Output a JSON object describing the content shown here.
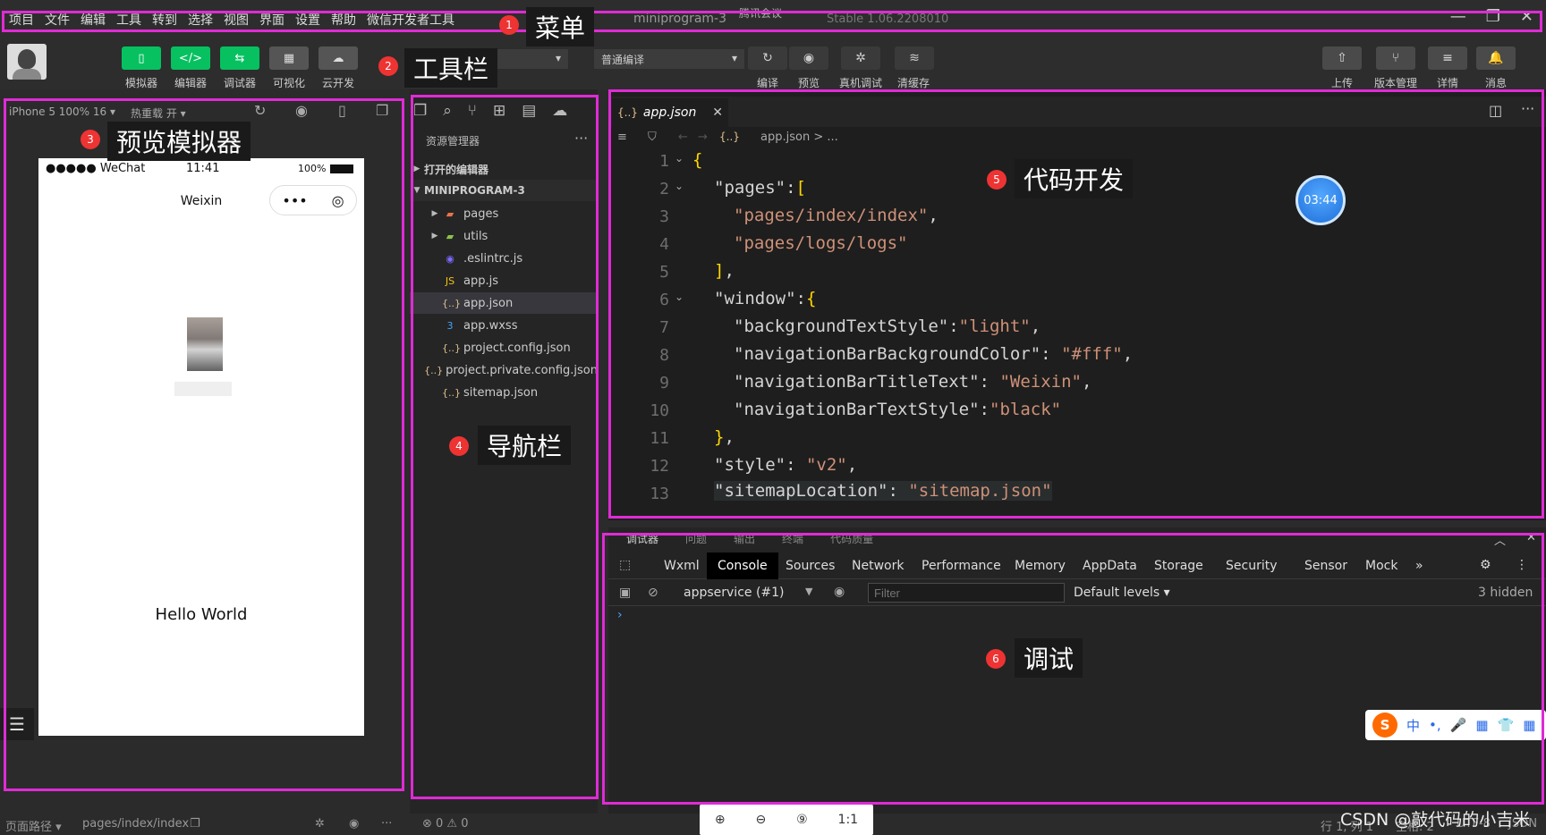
{
  "menubar": {
    "items": [
      "项目",
      "文件",
      "编辑",
      "工具",
      "转到",
      "选择",
      "视图",
      "界面",
      "设置",
      "帮助",
      "微信开发者工具"
    ],
    "window_title": "miniprogram-3",
    "meeting": "腾讯会议",
    "version": "Stable 1.06.2208010",
    "controls": [
      "—",
      "❐",
      "✕"
    ]
  },
  "toolbar": {
    "mode_buttons": [
      {
        "label": "模拟器",
        "icon": "▯"
      },
      {
        "label": "编辑器",
        "icon": "</>"
      },
      {
        "label": "调试器",
        "icon": "⇆"
      },
      {
        "label": "可视化",
        "icon": "▦"
      },
      {
        "label": "云开发",
        "icon": "☁"
      }
    ],
    "compile_mode": "普通编译",
    "actions": [
      {
        "label": "编译",
        "icon": "↻"
      },
      {
        "label": "预览",
        "icon": "◉"
      },
      {
        "label": "真机调试",
        "icon": "✲"
      },
      {
        "label": "清缓存",
        "icon": "≋"
      }
    ],
    "right_actions": [
      {
        "label": "上传",
        "icon": "⇧"
      },
      {
        "label": "版本管理",
        "icon": "⑂"
      },
      {
        "label": "详情",
        "icon": "≡"
      },
      {
        "label": "消息",
        "icon": "🔔"
      }
    ]
  },
  "simulator": {
    "device": "iPhone 5 100% 16 ▾",
    "hot_reload": "热重载 开 ▾",
    "status_left": "●●●●● WeChat",
    "status_time": "11:41",
    "status_battery": "100%",
    "nav_title": "Weixin",
    "hello": "Hello World"
  },
  "explorer": {
    "header": "资源管理器",
    "open_editors": "打开的编辑器",
    "project": "MINIPROGRAM-3",
    "items": [
      {
        "name": "pages",
        "icon": "▰",
        "color": "#e8734a",
        "folder": true
      },
      {
        "name": "utils",
        "icon": "▰",
        "color": "#8bc34a",
        "folder": true
      },
      {
        "name": ".eslintrc.js",
        "icon": "◉",
        "color": "#7c6bff",
        "folder": false
      },
      {
        "name": "app.js",
        "icon": "JS",
        "color": "#f1c40f",
        "folder": false
      },
      {
        "name": "app.json",
        "icon": "{..}",
        "color": "#e2c08d",
        "folder": false
      },
      {
        "name": "app.wxss",
        "icon": "3",
        "color": "#42a5f5",
        "folder": false
      },
      {
        "name": "project.config.json",
        "icon": "{..}",
        "color": "#e2c08d",
        "folder": false
      },
      {
        "name": "project.private.config.json",
        "icon": "{..}",
        "color": "#e2c08d",
        "folder": false
      },
      {
        "name": "sitemap.json",
        "icon": "{..}",
        "color": "#e2c08d",
        "folder": false
      }
    ]
  },
  "editor": {
    "tab_name": "app.json",
    "breadcrumb": "app.json > ...",
    "timer": "03:44"
  },
  "debugger": {
    "top_tabs": [
      "调试器",
      "问题",
      "输出",
      "终端",
      "代码质量"
    ],
    "tabs": [
      "Wxml",
      "Console",
      "Sources",
      "Network",
      "Performance",
      "Memory",
      "AppData",
      "Storage",
      "Security",
      "Sensor",
      "Mock",
      "»"
    ],
    "context": "appservice (#1)",
    "filter_placeholder": "Filter",
    "levels": "Default levels ▾",
    "hidden": "3 hidden"
  },
  "ime": {
    "chars": [
      "中",
      "•,",
      "🎤",
      "▦",
      "👕",
      "▦"
    ]
  },
  "statusbar": {
    "page_path_label": "页面路径 ▾",
    "page_path": "pages/index/index",
    "errors": "⊗ 0 ⚠ 0",
    "cursor": "行 1, 列 1",
    "spaces": "空格: 2",
    "encoding": "UTF-8",
    "lang": "JSON"
  },
  "zoom": [
    "⊕",
    "⊖",
    "⑨",
    "1:1"
  ],
  "watermark": "CSDN @敲代码的小吉米",
  "annotations": [
    {
      "num": "1",
      "label": "菜单"
    },
    {
      "num": "2",
      "label": "工具栏"
    },
    {
      "num": "3",
      "label": "预览模拟器"
    },
    {
      "num": "4",
      "label": "导航栏"
    },
    {
      "num": "5",
      "label": "代码开发"
    },
    {
      "num": "6",
      "label": "调试"
    }
  ],
  "colors": {
    "annotation_border": "#e02bd6",
    "badge": "#ee3333",
    "brand": "#07c160"
  }
}
